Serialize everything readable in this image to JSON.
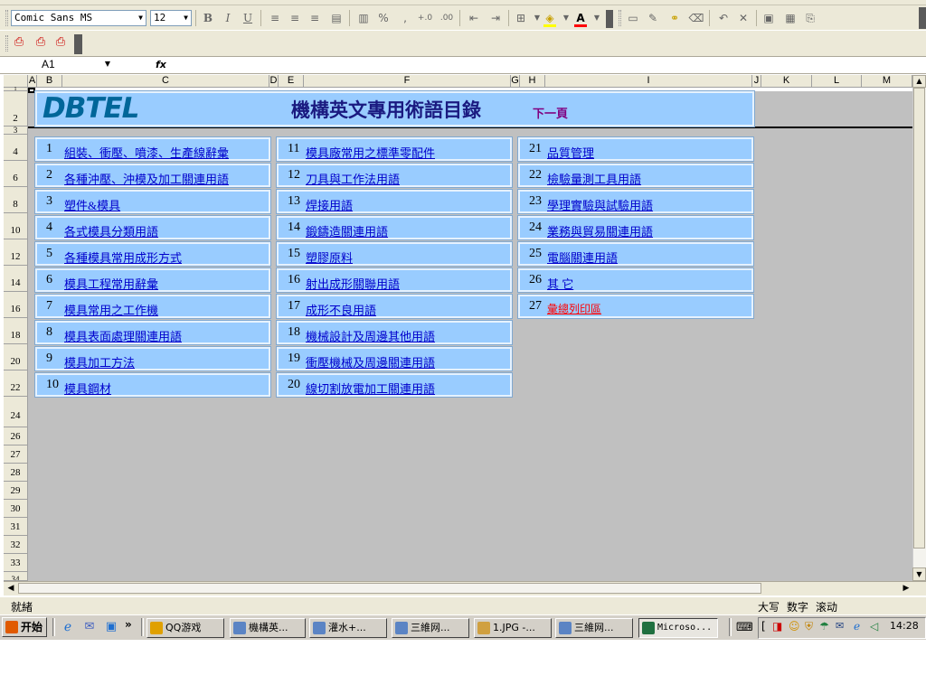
{
  "toolbar": {
    "font_name": "Comic Sans MS",
    "font_size": "12",
    "bold": "B",
    "italic": "I",
    "underline": "U",
    "percent": "%",
    "comma": ",",
    "inc_decimal": "+.0\n.00",
    "dec_decimal": ".00\n+.0",
    "font_color_letter": "A"
  },
  "formula_bar": {
    "name_box": "A1",
    "fx": "fx",
    "formula": ""
  },
  "columns": [
    "A",
    "B",
    "C",
    "D",
    "E",
    "F",
    "G",
    "H",
    "I",
    "J",
    "K",
    "L",
    "M"
  ],
  "rows": [
    "1",
    "2",
    "3",
    "4",
    "6",
    "8",
    "10",
    "12",
    "14",
    "16",
    "18",
    "20",
    "22",
    "24",
    "26",
    "27",
    "28",
    "29",
    "30",
    "31",
    "32",
    "33",
    "34"
  ],
  "sheet": {
    "logo": "DBTEL",
    "title": "機構英文專用術語目錄",
    "next_page": "下一頁",
    "col1": [
      {
        "num": "1",
        "label": "組裝、衝壓、噴漆、生產線辭彙"
      },
      {
        "num": "2",
        "label": "各種沖壓、沖模及加工關連用語"
      },
      {
        "num": "3",
        "label": "塑件&模具"
      },
      {
        "num": "4",
        "label": "各式模具分類用語"
      },
      {
        "num": "5",
        "label": "各種模具常用成形方式"
      },
      {
        "num": "6",
        "label": "模具工程常用辭彙"
      },
      {
        "num": "7",
        "label": "模具常用之工作機"
      },
      {
        "num": "8",
        "label": "模具表面處理關連用語"
      },
      {
        "num": "9",
        "label": "模具加工方法"
      },
      {
        "num": "10",
        "label": "模具鋼材"
      }
    ],
    "col2": [
      {
        "num": "11",
        "label": "模具廠常用之標準零配件"
      },
      {
        "num": "12",
        "label": "刀具與工作法用語"
      },
      {
        "num": "13",
        "label": "焊接用語"
      },
      {
        "num": "14",
        "label": "鍛鑄造關連用語"
      },
      {
        "num": "15",
        "label": "塑膠原料"
      },
      {
        "num": "16",
        "label": "射出成形關聯用語"
      },
      {
        "num": "17",
        "label": "成形不良用語"
      },
      {
        "num": "18",
        "label": "機械設計及周邊其他用語"
      },
      {
        "num": "19",
        "label": "衝壓機械及周邊關連用語"
      },
      {
        "num": "20",
        "label": "線切割放電加工關連用語"
      }
    ],
    "col3": [
      {
        "num": "21",
        "label": "品質管理"
      },
      {
        "num": "22",
        "label": "檢驗量測工具用語"
      },
      {
        "num": "23",
        "label": "學理實驗與試驗用語"
      },
      {
        "num": "24",
        "label": "業務與貿易關連用語"
      },
      {
        "num": "25",
        "label": "電腦關連用語"
      },
      {
        "num": "26",
        "label": "其 它"
      },
      {
        "num": "27",
        "label": "彙總列印區"
      }
    ]
  },
  "status": {
    "ready": "就緒",
    "caps": "大写",
    "num": "数字",
    "scroll": "滚动"
  },
  "taskbar": {
    "start": "开始",
    "chevron": "»",
    "tasks": [
      "QQ游戏",
      "機構英...",
      "灌水+...",
      "三維网...",
      "1.JPG -...",
      "三維网...",
      "Microso..."
    ],
    "clock": "14:28"
  }
}
